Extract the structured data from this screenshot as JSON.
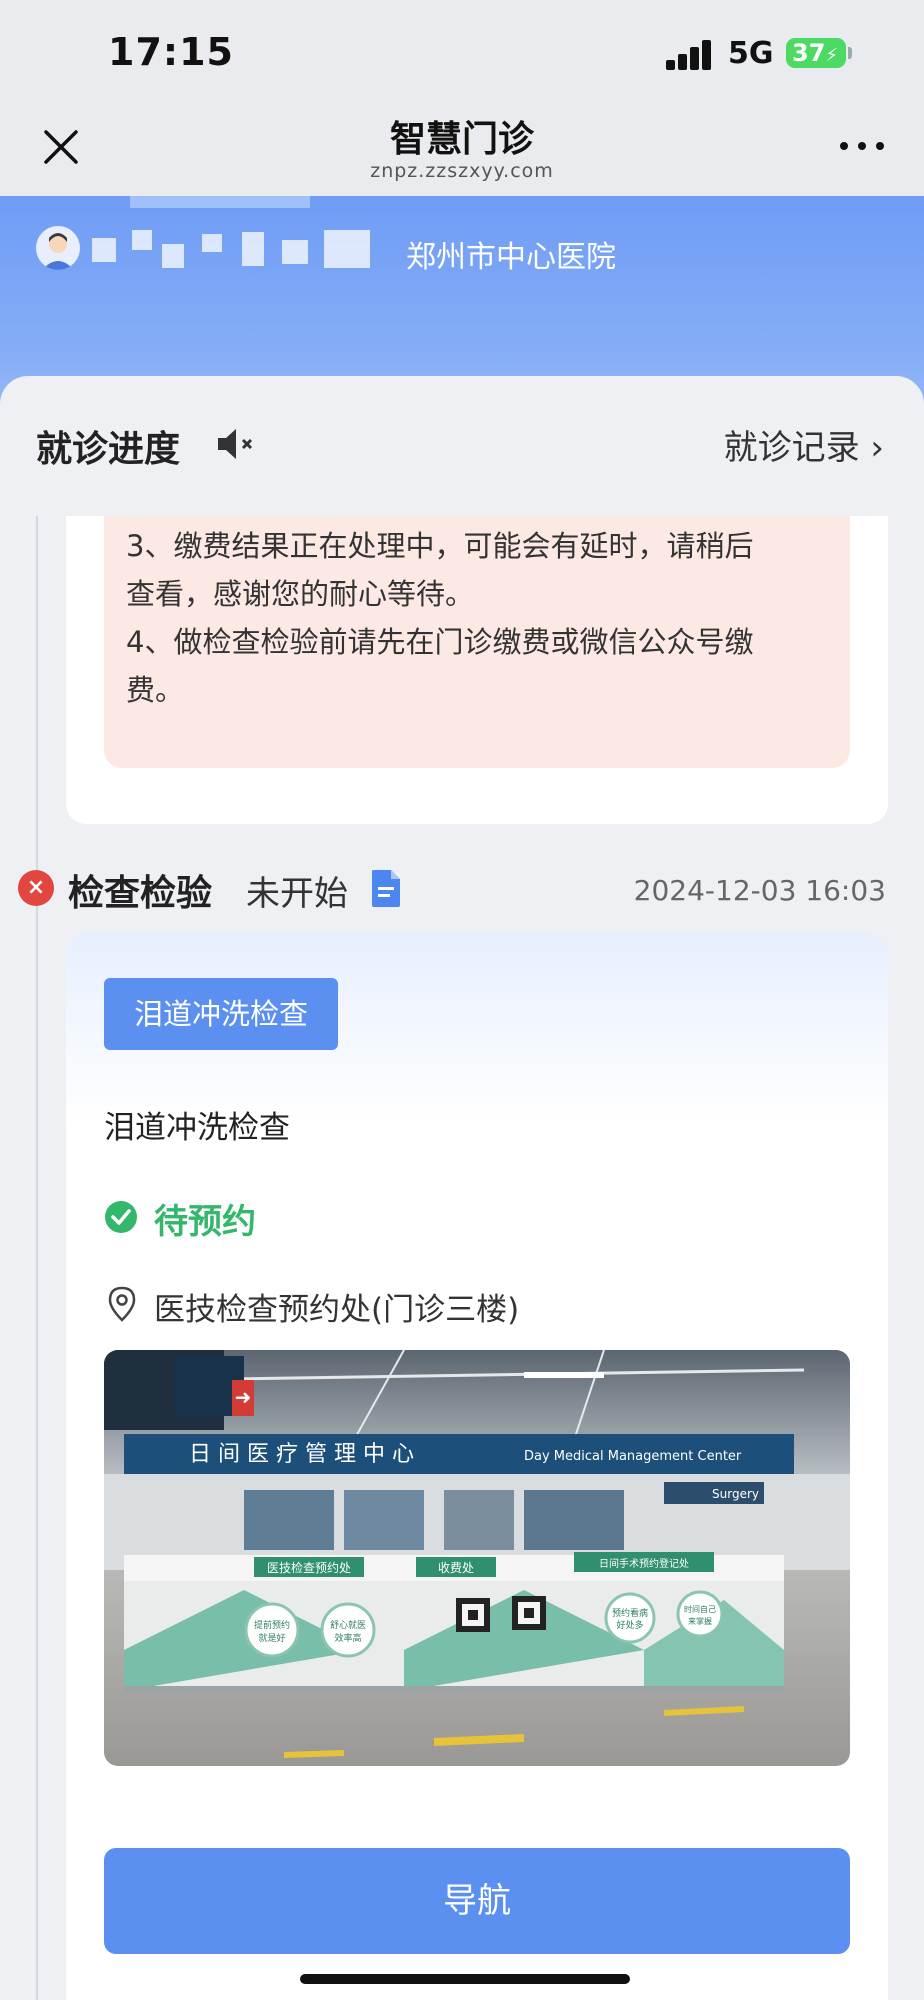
{
  "status_bar": {
    "time": "17:15",
    "network": "5G",
    "battery": "37"
  },
  "nav": {
    "title": "智慧门诊",
    "url": "znpz.zzszxyy.com",
    "close_icon": "close-icon",
    "more_icon": "more-icon"
  },
  "header": {
    "hospital": "郑州市中心医院",
    "avatar_icon": "avatar-icon"
  },
  "progress": {
    "title": "就诊进度",
    "mute_icon": "speaker-mute-icon",
    "records_label": "就诊记录 ›"
  },
  "notice": {
    "lines": [
      "3、缴费结果正在处理中，可能会有延时，请稍后",
      "查看，感谢您的耐心等待。",
      "4、做检查检验前请先在门诊缴费或微信公众号缴",
      "费。"
    ]
  },
  "exam_section": {
    "title": "检查检验",
    "status": "未开始",
    "time": "2024-12-03 16:03",
    "status_icon": "close-circle-icon",
    "doc_icon": "document-icon"
  },
  "exam_card": {
    "tag": "泪道冲洗检查",
    "name": "泪道冲洗检查",
    "status": "待预约",
    "location": "医技检查预约处(门诊三楼)",
    "photo_signs": {
      "main_sign": "日 间 医 疗 管 理 中 心",
      "main_sign_en": "Day Medical Management Center",
      "counter_1": "医技检查预约处",
      "counter_2": "收费处",
      "counter_3": "日间手术预约登记处",
      "badge_1": "提前预约 就是好",
      "badge_2": "舒心就医 效率高",
      "badge_3": "预约看病 好处多",
      "badge_4": "时间自己 来掌握",
      "surgery_sign": "Surgery"
    },
    "nav_button": "导航"
  },
  "colors": {
    "accent": "#5b8ff0",
    "success": "#33b76b",
    "danger": "#e3453f",
    "notice_bg": "#fde9e4"
  }
}
